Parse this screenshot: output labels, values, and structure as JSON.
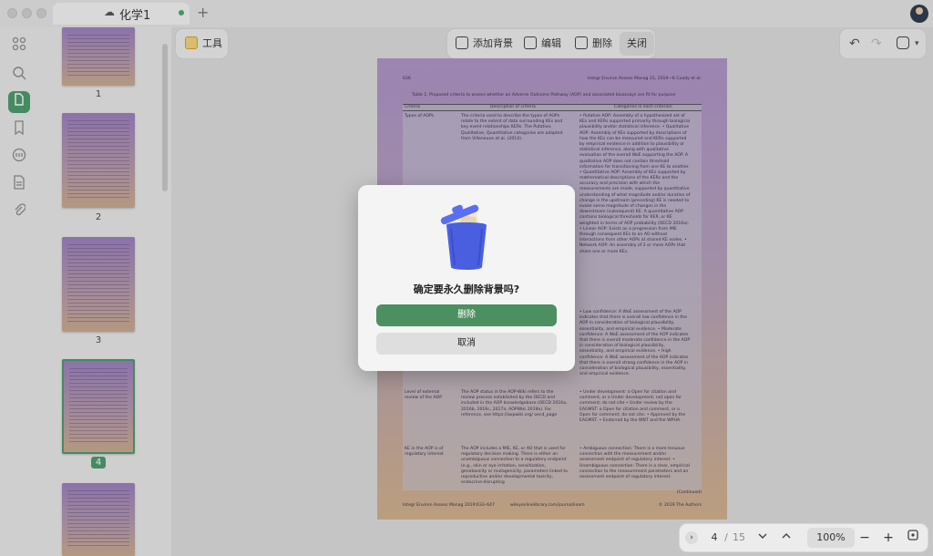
{
  "tab": {
    "title": "化学1"
  },
  "toolbar": {
    "tools_label": "工具",
    "add_background": "添加背景",
    "edit": "编辑",
    "delete": "删除",
    "close": "关闭"
  },
  "thumbnails": [
    {
      "label": "1"
    },
    {
      "label": "2"
    },
    {
      "label": "3"
    },
    {
      "label": "4",
      "selected": true
    },
    {
      "label": ""
    }
  ],
  "document": {
    "header_left": "636",
    "header_right": "Integr Environ Assess Manag 15, 2019—K Coady et al.",
    "caption": "Table 1. Proposed criteria to assess whether an Adverse Outcome Pathway (AOP) and associated bioassays are fit for purpose",
    "col_headers": [
      "Criteria",
      "Description of criteria",
      "Categories in each criterion"
    ],
    "rows": [
      {
        "criteria": "Types of AOPs",
        "description": "The criteria used to describe the types of AOPs relate to the extent of data surrounding KEs and key event relationships KERs. The Putative, Qualitative, Quantitative categories are adapted from Villeneuve et al. (2014).",
        "categories": "• Putative AOP: Assembly of a hypothesized set of KEs and KERs supported primarily through biological plausibility and/or statistical inference. • Qualitative AOP: Assembly of KEs supported by descriptions of how the KEs can be measured and KERs supported by empirical evidence in addition to plausibility or statistical inference, along with qualitative evaluation of the overall WoE supporting the AOP. A qualitative AOP does not contain threshold information for transitioning from one KE to another. • Quantitative AOP: Assembly of KEs supported by mathematical descriptions of the KERs and the accuracy and precision with which the measurements are made, supported by quantitative understanding of what magnitude and/or duration of change in the upstream (preceding) KE is needed to evoke some magnitude of changes in the downstream (subsequent) KE. A quantitative AOP contains biological thresholds for KER, or KE weighted in terms of AOP probability (OECD 2016a). • Linear AOP: Exists as a progression from MIE through consequent KEs to an AO without interactions from other AOPs at shared KE nodes. • Network AOP: An assembly of 2 or more AOPs that share one or more KEs."
      },
      {
        "criteria": "",
        "description": "",
        "categories": "• Low confidence: A WoE assessment of the AOP indicates that there is overall low confidence in the AOP in consideration of biological plausibility, essentiality, and empirical evidence. • Moderate confidence: A WoE assessment of the AOP indicates that there is overall moderate confidence in the AOP in consideration of biological plausibility, essentiality, and empirical evidence. • High confidence: A WoE assessment of the AOP indicates that there is overall strong confidence in the AOP in consideration of biological plausibility, essentiality, and empirical evidence."
      },
      {
        "criteria": "Level of external review of the AOP",
        "description": "The AOP status in the AOP-Wiki refers to the review process established by the OECD and included in the AOP knowledgebase (OECD 2016a, 2016b, 2016c, 2017a; AOPWiki 2019a). For reference, see https://aopwiki.org/ oecd_page",
        "categories": "• Under development: o Open for citation and comment, or o Under development; not open for comment; do not cite • Under review by the EAGMST: o Open for citation and comment, or o Open for comment; do not cite. • Approved by the EAGMST. • Endorsed by the WNT and the WPHA."
      },
      {
        "criteria": "KE in the AOP is of regulatory interest",
        "description": "The AOP includes a MIE, KE, or AO that is used for regulatory decision making. There is either an unambiguous connection to a regulatory endpoint (e.g., skin or eye irritation, sensitization, genotoxicity or mutagenicity, parameters linked to reproductive and/or developmental toxicity, endocrine-disrupting",
        "categories": "• Ambiguous connection: There is a more tenuous connection with the measurement and/or assessment endpoint of regulatory interest. • Unambiguous connection: There is a clear, empirical connection to the measurement parameters and an assessment endpoint of regulatory interest."
      }
    ],
    "continued": "(Continued)",
    "footer_left": "Integr Environ Assess Manag 2019:633–647",
    "footer_center": "wileyonlinelibrary.com/journal/ieam",
    "footer_right": "© 2019 The Authors"
  },
  "dialog": {
    "message": "确定要永久删除背景吗?",
    "confirm_label": "删除",
    "cancel_label": "取消"
  },
  "pager": {
    "current_page": "4",
    "separator": "/",
    "total_pages": "15",
    "zoom": "100%"
  },
  "colors": {
    "accent": "#4a9a6a",
    "primary_button": "#4c8f60",
    "trash_blue": "#4a5fe0"
  }
}
